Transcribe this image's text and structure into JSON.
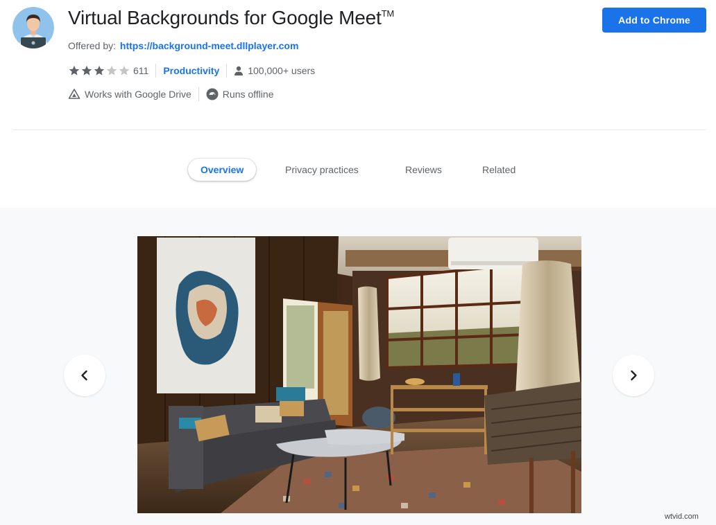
{
  "app": {
    "title": "Virtual Backgrounds for Google Meet",
    "trademark": "TM",
    "offered_by_label": "Offered by:",
    "offered_by_url": "https://background-meet.dllplayer.com",
    "logo_icon": "person-with-laptop-icon"
  },
  "rating": {
    "stars": 3,
    "max_stars": 5,
    "count": "611",
    "star_color": "#5f6368",
    "empty_star_color": "#c5c5c5"
  },
  "category": "Productivity",
  "users": "100,000+ users",
  "features": [
    {
      "label": "Works with Google Drive",
      "icon": "google-drive-icon"
    },
    {
      "label": "Runs offline",
      "icon": "offline-check-icon"
    }
  ],
  "actions": {
    "add_to_chrome": "Add to Chrome",
    "accent_color": "#1a73e8"
  },
  "tabs": [
    {
      "label": "Overview",
      "active": true
    },
    {
      "label": "Privacy practices",
      "active": false
    },
    {
      "label": "Reviews",
      "active": false
    },
    {
      "label": "Related",
      "active": false
    }
  ],
  "gallery": {
    "image": "living-room-photo",
    "prev_icon": "chevron-left-icon",
    "next_icon": "chevron-right-icon"
  },
  "watermark": "wtvid.com"
}
